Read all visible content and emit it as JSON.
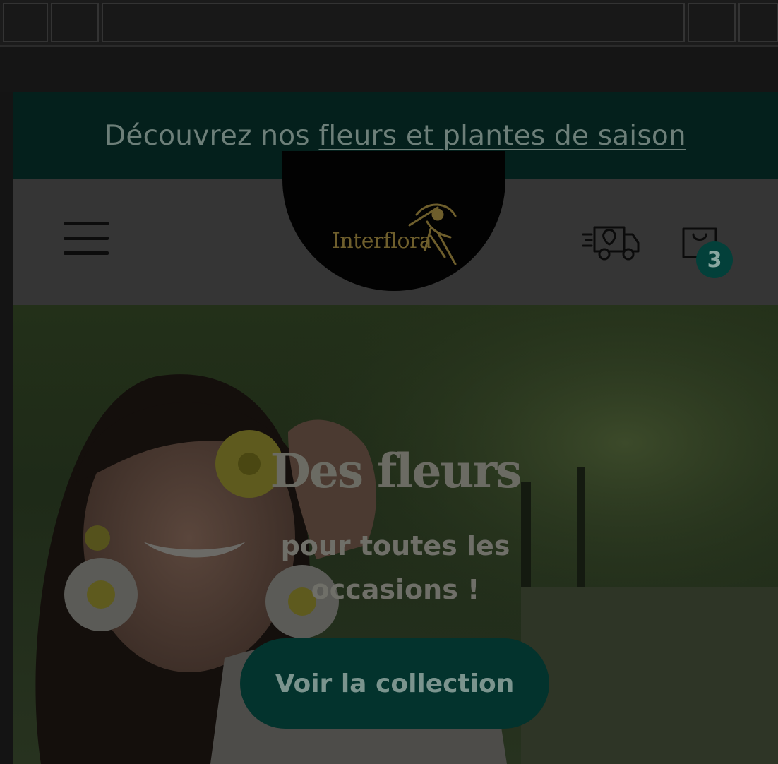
{
  "promo": {
    "prefix": "Découvrez nos ",
    "link": "fleurs et plantes de saison"
  },
  "header": {
    "menu_icon": "hamburger-menu-icon",
    "brand": "Interflora",
    "delivery_icon": "delivery-truck-icon",
    "cart_icon": "shopping-bag-icon",
    "cart_count": "3"
  },
  "hero": {
    "title": "Des fleurs",
    "subtitle_line1": "pour toutes les",
    "subtitle_line2": "occasions !",
    "cta_label": "Voir la collection"
  },
  "colors": {
    "promo_bg": "#04201c",
    "accent": "#03403a",
    "header_bg": "#353535",
    "logo_bg": "#020202",
    "gold": "#6e5e2c"
  }
}
